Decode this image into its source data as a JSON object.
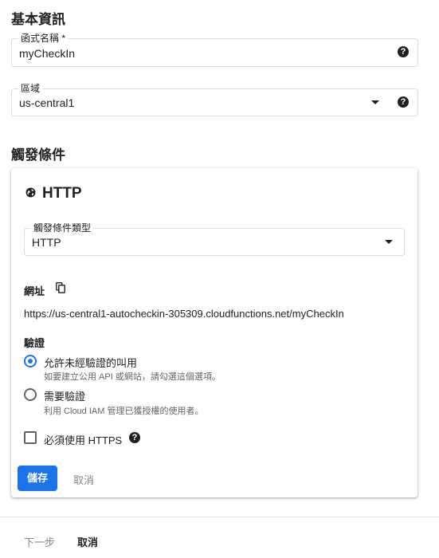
{
  "basic_info": {
    "heading": "基本資訊",
    "function_name": {
      "label": "函式名稱 *",
      "value": "myCheckIn"
    },
    "region": {
      "label": "區域",
      "value": "us-central1"
    }
  },
  "trigger": {
    "heading": "觸發條件",
    "card_title": "HTTP",
    "trigger_type": {
      "label": "觸發條件類型",
      "value": "HTTP"
    },
    "url_label": "網址",
    "url_value": "https://us-central1-autocheckin-305309.cloudfunctions.net/myCheckIn",
    "auth_label": "驗證",
    "auth_options": [
      {
        "label": "允許未經驗證的叫用",
        "description": "如要建立公用 API 或網站，請勾選這個選項。",
        "selected": true
      },
      {
        "label": "需要驗證",
        "description": "利用 Cloud IAM 管理已獲授權的使用者。",
        "selected": false
      }
    ],
    "require_https": {
      "label": "必須使用 HTTPS",
      "checked": false
    },
    "save_label": "儲存",
    "cancel_label": "取消"
  },
  "footer": {
    "next_label": "下一步",
    "cancel_label": "取消"
  },
  "colors": {
    "primary": "#1a73e8",
    "text": "#202124",
    "secondary_text": "#5f6368",
    "disabled": "#80868b"
  },
  "icons": [
    "help-icon",
    "dropdown-caret-icon",
    "globe-icon",
    "copy-icon"
  ]
}
